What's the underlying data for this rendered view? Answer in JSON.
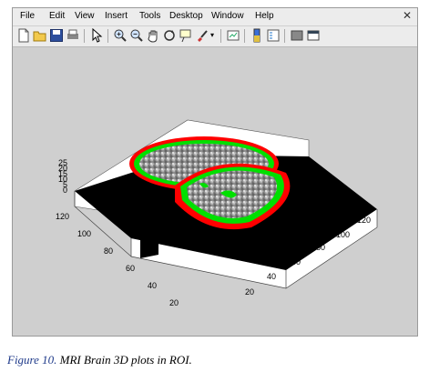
{
  "menu": [
    "File",
    "Edit",
    "View",
    "Insert",
    "Tools",
    "Desktop",
    "Window",
    "Help"
  ],
  "toolbar_icons": [
    "new-figure-icon",
    "open-file-icon",
    "save-icon",
    "print-icon",
    "select-arrow-icon",
    "zoom-in-icon",
    "zoom-out-icon",
    "pan-hand-icon",
    "rotate-3d-icon",
    "data-cursor-icon",
    "brush-icon",
    "link-plot-icon",
    "colorbar-icon",
    "legend-icon",
    "hide-plot-tools-icon",
    "show-plot-tools-icon"
  ],
  "axes": {
    "z_ticks": [
      "25",
      "20",
      "15",
      "10",
      "5",
      "0"
    ],
    "y_ticks": [
      "120",
      "100",
      "80",
      "60",
      "40",
      "20"
    ],
    "x_ticks": [
      "20",
      "40",
      "60",
      "80",
      "100",
      "120"
    ]
  },
  "colors": {
    "outer_ring": "#ff0000",
    "inner_ring": "#00e000",
    "slice_floor": "#000000"
  },
  "caption": {
    "label": "Figure 10.",
    "text": " MRI Brain 3D plots in ROI."
  }
}
